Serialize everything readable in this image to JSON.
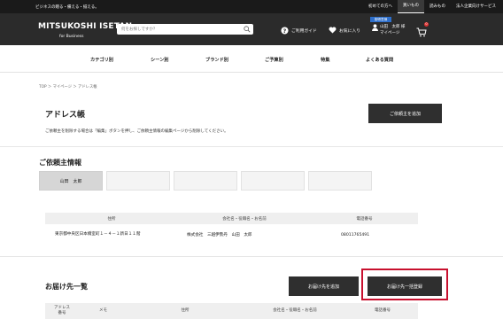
{
  "topbar": {
    "tagline": "ビジネスの贈る・備える・揃える。",
    "links": [
      {
        "label": "初めての方へ",
        "active": false
      },
      {
        "label": "買いもの",
        "active": true
      },
      {
        "label": "読みもの",
        "active": false
      },
      {
        "label": "法人企業向けサービス",
        "active": false
      }
    ]
  },
  "header": {
    "logo": "MITSUKOSHI ISETAN",
    "logo_sub": "for Business",
    "search_placeholder": "何をお探しですか？",
    "guide_label": "ご利用ガイド",
    "fav_label": "お気に入り",
    "user_badge": "御得意様",
    "user_name": "山田　太郎 様",
    "mypage_label": "マイページ",
    "cart_count": "0"
  },
  "nav": {
    "items": [
      "カテゴリ別",
      "シーン別",
      "ブランド別",
      "ご予算別",
      "特集",
      "よくある質問"
    ]
  },
  "breadcrumb": "TOP ＞ マイページ ＞ アドレス帳",
  "address_book": {
    "title": "アドレス帳",
    "add_client_button": "ご依頼主を追加",
    "description": "ご依頼主を削除する場合は「編集」ボタンを押し、ご依頼主情報の編集ページから削除してください。"
  },
  "client_info": {
    "title": "ご依頼主情報",
    "tabs": [
      "山田　太郎",
      "",
      "",
      "",
      ""
    ],
    "table": {
      "headers": [
        "住所",
        "会社名・役職名・お名前",
        "電話番号"
      ],
      "rows": [
        {
          "address": "東京都中央区日本橋室町１－４－１新日１１階",
          "name": "株式会社　三越伊勢丹　山田　太郎",
          "phone": "08011765491"
        }
      ]
    }
  },
  "destinations": {
    "title": "お届け先一覧",
    "add_button": "お届け先を追加",
    "bulk_register_button": "お届け先一括登録",
    "table_headers": [
      "アドレス\n番号",
      "メモ",
      "住所",
      "会社名・役職名・お名前",
      "電話番号"
    ]
  },
  "colors": {
    "header_bg": "#2b2b2b",
    "button_bg": "#2f2f2f",
    "highlight": "#c8102e",
    "badge": "#2e6fcb"
  }
}
